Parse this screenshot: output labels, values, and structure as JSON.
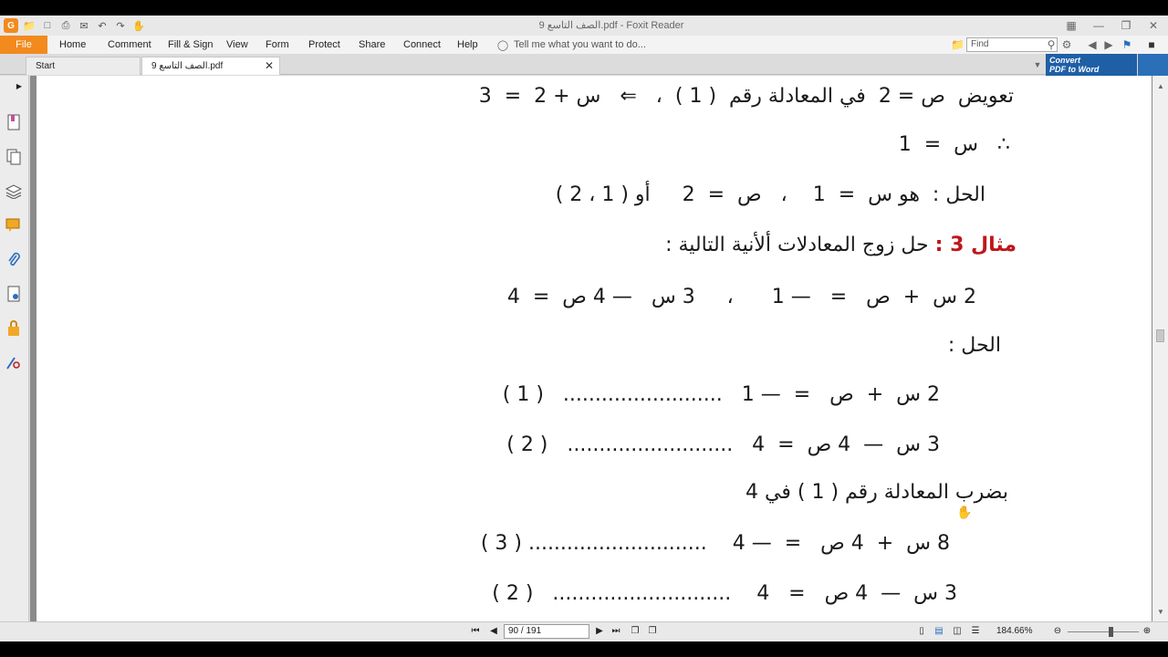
{
  "window": {
    "title": "الصف التاسع 9.pdf - Foxit Reader",
    "logo": "G"
  },
  "menu": {
    "file": "File",
    "items": [
      "Home",
      "Comment",
      "Fill & Sign",
      "View",
      "Form",
      "Protect",
      "Share",
      "Connect",
      "Help"
    ],
    "tell_me": "Tell me what you want to do...",
    "find_placeholder": "Find"
  },
  "tabs": {
    "start": "Start",
    "document": "الصف التاسع 9.pdf",
    "convert": [
      "Convert",
      "PDF to Word"
    ]
  },
  "document": {
    "lines": [
      "تعويض  ص = 2  في المعادلة رقم  ( 1 )  ،   ⇐   س + 2  =  3",
      "∴   س  =  1",
      "الحل :  هو س  =  1    ،   ص  =  2     أو ( 1 ، 2 )",
      "حل زوج المعادلات ألأنية التالية :",
      "2 س  +  ص   =   — 1      ،     3 س   — 4 ص  =  4",
      "الحل :",
      "2 س  +  ص   =  — 1   .........................   ( 1 )",
      "3 س  —  4 ص  =  4   ..........................   ( 2 )",
      "بضرب المعادلة رقم ( 1 ) في 4",
      "8 س  +  4 ص   =  — 4    ............................ ( 3 )",
      "3 س  —  4 ص   =   4    ............................   ( 2 )"
    ],
    "example_label": "مثال 3 :"
  },
  "status": {
    "page_indicator": "90 / 191",
    "zoom": "184.66%"
  },
  "colors": {
    "accent": "#f28a1e",
    "example_red": "#c0161b",
    "convert_blue": "#1e5fa6"
  }
}
